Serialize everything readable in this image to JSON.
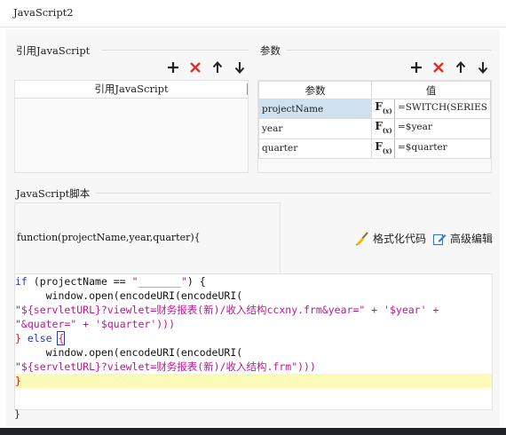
{
  "window": {
    "title": "JavaScript2"
  },
  "ref_section": {
    "title": "引用JavaScript",
    "column_header": "引用JavaScript",
    "rows": []
  },
  "params_section": {
    "title": "参数",
    "headers": {
      "name": "参数",
      "value": "值"
    },
    "rows": [
      {
        "name": "projectName",
        "value": "=SWITCH(SERIES",
        "selected": true
      },
      {
        "name": "year",
        "value": "=$year",
        "selected": false
      },
      {
        "name": "quarter",
        "value": "=$quarter",
        "selected": false
      }
    ]
  },
  "script_section": {
    "title": "JavaScript脚本",
    "signature": "function(projectName,year,quarter){",
    "format_label": "格式化代码",
    "advanced_label": "高级编辑",
    "closing": "}",
    "code": {
      "l1_kw": "if",
      "l1_plain": " (projectName == ",
      "l1_str": "\"_______\"",
      "l1_end": ") {",
      "l2": "     window.open(encodeURI(encodeURI(",
      "l3": "\"${servletURL}?viewlet=财务报表(新)/收入结构ccxny.frm&year=\" + '$year' +",
      "l4": "\"&quater=\" + '$quarter')))",
      "l5_brace": "}",
      "l5_kw": " else ",
      "l5_brace2": "{",
      "l6": "     window.open(encodeURI(encodeURI(",
      "l7": "\"${servletURL}?viewlet=财务报表(新)/收入结构.frm\")))",
      "l8": "}"
    }
  },
  "icons": {
    "add": "plus-icon",
    "delete": "x-icon",
    "up": "arrow-up-icon",
    "down": "arrow-down-icon",
    "format": "broom-icon",
    "advanced": "edit-icon",
    "fx": "fx-icon"
  },
  "colors": {
    "keyword": "#2038c8",
    "string": "#b8198a",
    "delete_icon": "#e0302a",
    "selected_row": "#cfe0ee",
    "current_line": "#fbfbb8"
  }
}
